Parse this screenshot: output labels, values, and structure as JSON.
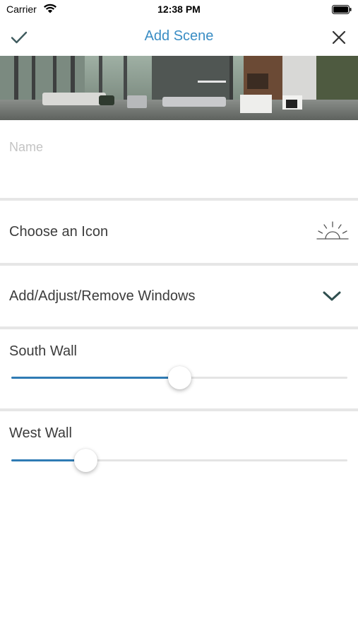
{
  "status_bar": {
    "carrier": "Carrier",
    "time": "12:38 PM"
  },
  "nav": {
    "title": "Add Scene",
    "confirm_icon": "checkmark-icon",
    "close_icon": "close-icon"
  },
  "banner": {
    "description": ""
  },
  "name_field": {
    "placeholder": "Name",
    "value": ""
  },
  "rows": {
    "icon": {
      "label": "Choose an Icon",
      "icon": "sunrise-icon"
    },
    "windows": {
      "label": "Add/Adjust/Remove Windows",
      "icon": "chevron-down-icon"
    }
  },
  "sliders": [
    {
      "label": "South Wall",
      "value": 0.5
    },
    {
      "label": "West Wall",
      "value": 0.22
    }
  ],
  "colors": {
    "accent": "#3a8dc4",
    "slider_fill": "#2f7bb4",
    "divider": "#e6e6e6"
  }
}
